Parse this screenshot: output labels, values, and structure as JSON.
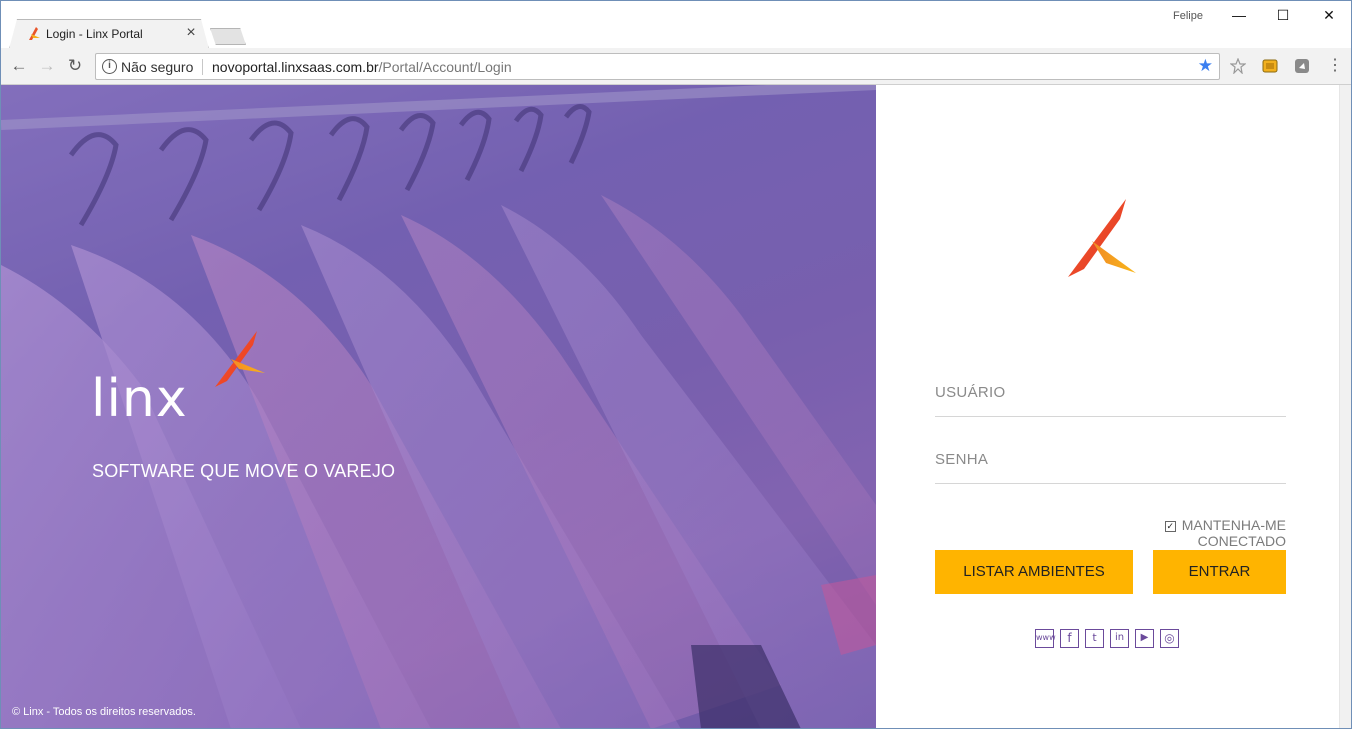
{
  "browser": {
    "tab_title": "Login - Linx Portal",
    "profile_name": "Felipe",
    "security_label": "Não seguro",
    "url_host": "novoportal.linxsaas.com.br",
    "url_path": "/Portal/Account/Login"
  },
  "hero": {
    "brand": "Linx",
    "tagline": "SOFTWARE QUE MOVE O VAREJO",
    "copyright": "© Linx - Todos os direitos reservados."
  },
  "login": {
    "username_placeholder": "USUÁRIO",
    "password_placeholder": "SENHA",
    "remember_label": "MANTENHA-ME CONECTADO",
    "remember_checked": true,
    "list_button": "LISTAR AMBIENTES",
    "submit_button": "ENTRAR"
  },
  "social": [
    {
      "icon": "www-icon",
      "glyph": "www"
    },
    {
      "icon": "facebook-icon",
      "glyph": "f"
    },
    {
      "icon": "twitter-icon",
      "glyph": "t"
    },
    {
      "icon": "linkedin-icon",
      "glyph": "in"
    },
    {
      "icon": "youtube-icon",
      "glyph": "▶"
    },
    {
      "icon": "instagram-icon",
      "glyph": "◎"
    }
  ],
  "colors": {
    "accent": "#ffb400",
    "brand_purple": "#6b4a9b",
    "hero_overlay": "#7b66b7"
  }
}
